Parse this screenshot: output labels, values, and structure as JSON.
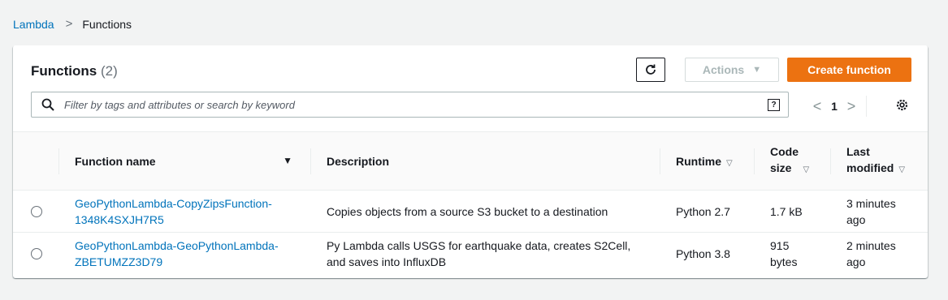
{
  "breadcrumb": {
    "root": "Lambda",
    "separator": ">",
    "current": "Functions"
  },
  "panel": {
    "title": "Functions",
    "count": "(2)"
  },
  "toolbar": {
    "actions_label": "Actions",
    "create_label": "Create function"
  },
  "search": {
    "placeholder": "Filter by tags and attributes or search by keyword",
    "help_glyph": "?"
  },
  "pagination": {
    "prev": "<",
    "page": "1",
    "next": ">"
  },
  "table": {
    "columns": {
      "name": "Function name",
      "description": "Description",
      "runtime": "Runtime",
      "code_size_line1": "Code",
      "code_size_line2": "size",
      "last_modified_line1": "Last",
      "last_modified_line2": "modified"
    },
    "rows": [
      {
        "name_line1": "GeoPythonLambda-CopyZipsFunction-",
        "name_line2": "1348K4SXJH7R5",
        "description_line1": "Copies objects from a source S3 bucket to a destination",
        "description_line2": "",
        "runtime": "Python 2.7",
        "code_size_line1": "1.7 kB",
        "code_size_line2": "",
        "modified_line1": "3 minutes",
        "modified_line2": "ago"
      },
      {
        "name_line1": "GeoPythonLambda-GeoPythonLambda-",
        "name_line2": "ZBETUMZZ3D79",
        "description_line1": "Py Lambda calls USGS for earthquake data, creates S2Cell,",
        "description_line2": "and saves into InfluxDB",
        "runtime": "Python 3.8",
        "code_size_line1": "915",
        "code_size_line2": "bytes",
        "modified_line1": "2 minutes",
        "modified_line2": "ago"
      }
    ]
  },
  "colors": {
    "accent_orange": "#ec7211",
    "link_blue": "#0073bb",
    "background": "#f2f3f3"
  }
}
